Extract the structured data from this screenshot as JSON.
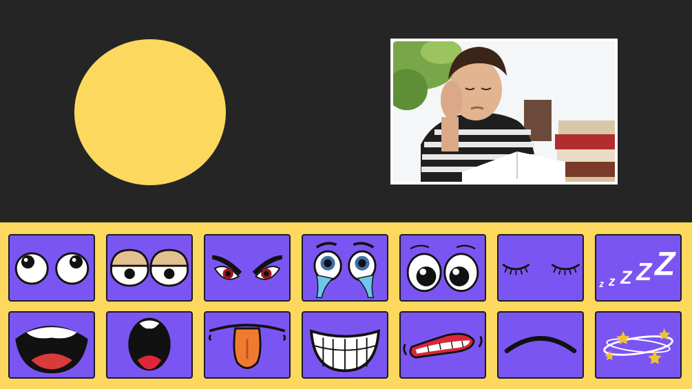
{
  "colors": {
    "background": "#252525",
    "face": "#fcd95e",
    "palette_bg": "#fcd95e",
    "tile": "#7b55f2",
    "tile_border": "#1c1a24"
  },
  "canvas": {
    "photo_alt": "boy-reading-bored-photo"
  },
  "palette": {
    "eyes": [
      {
        "name": "eyes-rolling-icon"
      },
      {
        "name": "eyes-sleepy-lidded-icon"
      },
      {
        "name": "eyes-angry-icon"
      },
      {
        "name": "eyes-crying-icon"
      },
      {
        "name": "eyes-wide-open-icon"
      },
      {
        "name": "eyes-closed-icon"
      },
      {
        "name": "zzz-sleep-icon",
        "text": "zzZZ"
      }
    ],
    "mouths": [
      {
        "name": "mouth-yelling-icon"
      },
      {
        "name": "mouth-surprised-icon"
      },
      {
        "name": "mouth-tongue-out-icon"
      },
      {
        "name": "mouth-big-grin-icon"
      },
      {
        "name": "mouth-grimace-icon"
      },
      {
        "name": "mouth-frown-icon"
      },
      {
        "name": "dizzy-stars-icon"
      }
    ]
  }
}
